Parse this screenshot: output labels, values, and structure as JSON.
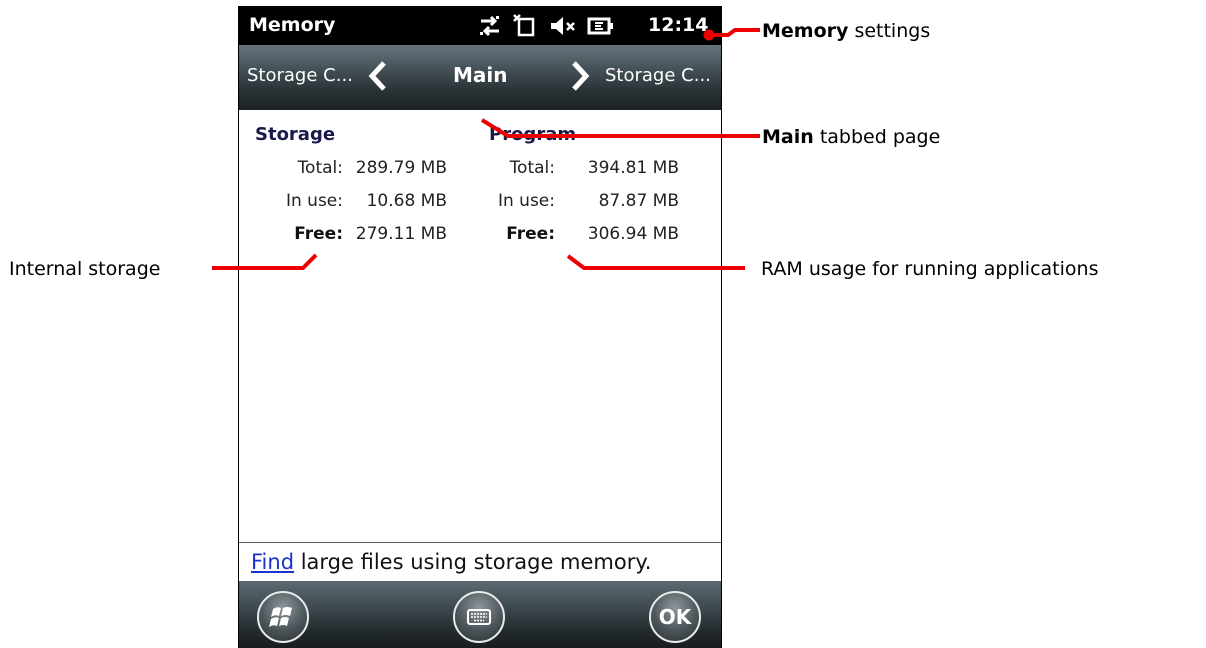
{
  "statusbar": {
    "title": "Memory",
    "time": "12:14",
    "icons": [
      "data-transfer-icon",
      "no-sim-icon",
      "speaker-muted-icon",
      "battery-charging-icon"
    ]
  },
  "tabs": {
    "left": "Storage C...",
    "center": "Main",
    "right": "Storage C..."
  },
  "storage": {
    "heading": "Storage",
    "rows": [
      {
        "label": "Total:",
        "value": "289.79 MB"
      },
      {
        "label": "In use:",
        "value": "10.68 MB"
      },
      {
        "label": "Free:",
        "value": "279.11 MB"
      }
    ]
  },
  "program": {
    "heading": "Program",
    "rows": [
      {
        "label": "Total:",
        "value": "394.81 MB"
      },
      {
        "label": "In use:",
        "value": "87.87 MB"
      },
      {
        "label": "Free:",
        "value": "306.94 MB"
      }
    ]
  },
  "footer": {
    "link": "Find",
    "text": " large files using storage memory."
  },
  "menubar": {
    "ok_label": "OK"
  },
  "annotations": {
    "memory_bold": "Memory",
    "memory_rest": " settings",
    "main_bold": "Main",
    "main_rest": " tabbed page",
    "internal": "Internal storage",
    "ram": "RAM usage for running applications"
  },
  "colors": {
    "annotation_line": "#ee0000",
    "link": "#1a33cc"
  }
}
